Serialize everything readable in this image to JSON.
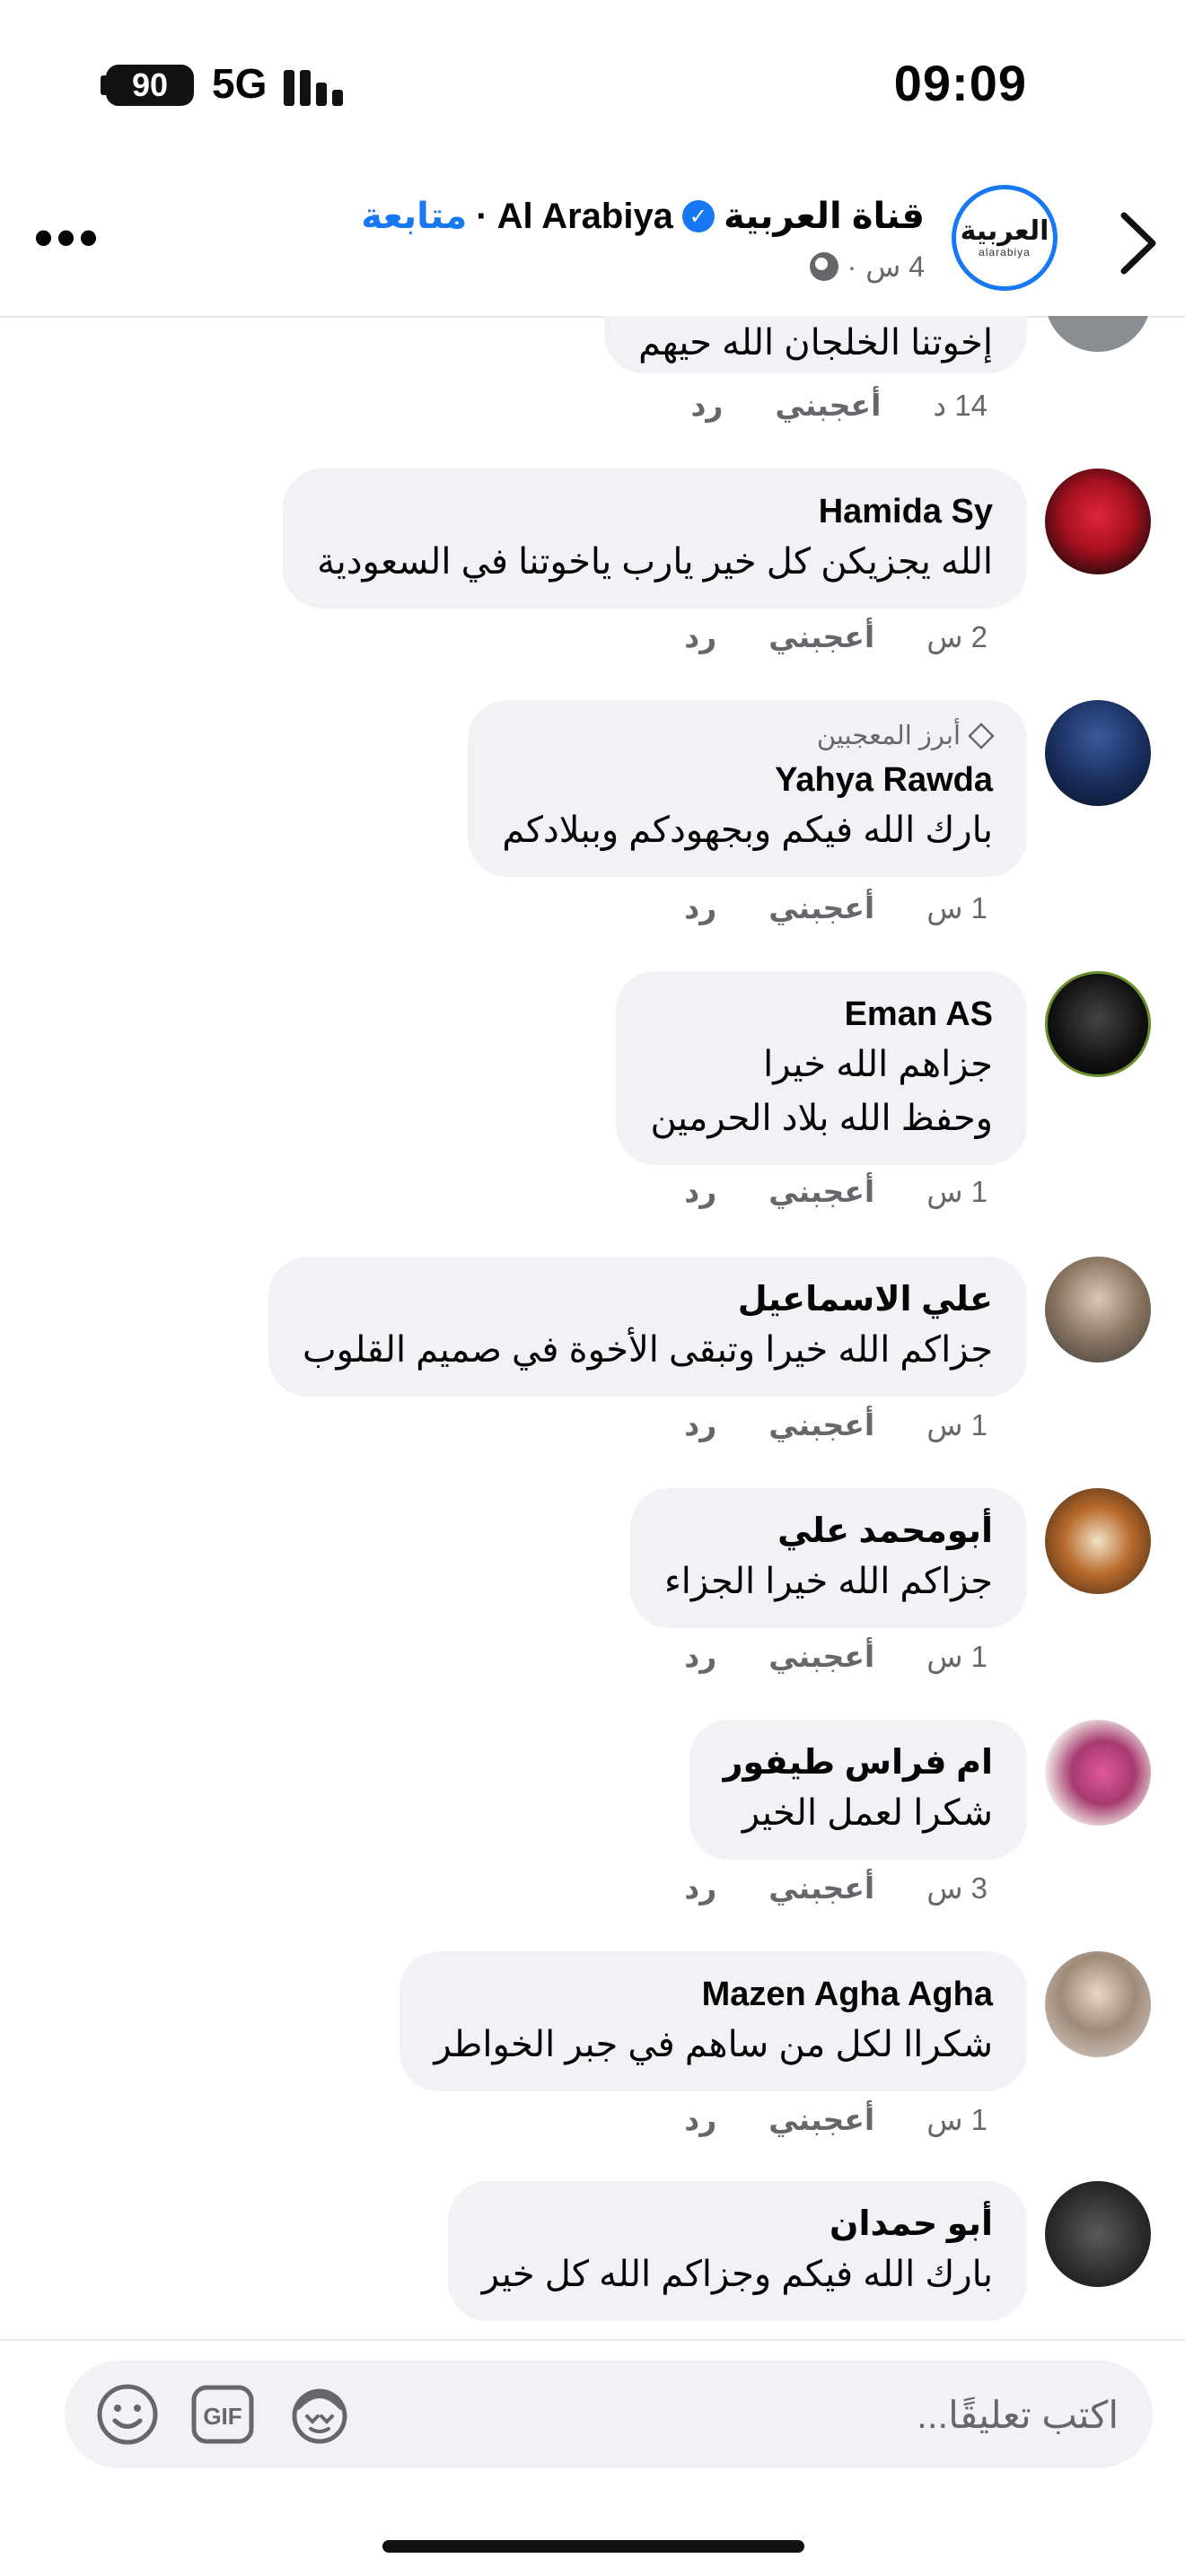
{
  "status_bar": {
    "battery": "90",
    "network": "5G",
    "time": "09:09"
  },
  "header": {
    "page_name": "قناة العربية",
    "page_name_en": "Al Arabiya",
    "separator": "·",
    "follow_label": "متابعة",
    "post_age": "4 س",
    "avatar_text_ar": "العربية",
    "avatar_text_en": "alarabiya"
  },
  "comments": [
    {
      "author": "",
      "text": "إخوتنا الخلجان الله حيهم",
      "time": "14 د",
      "like": "أعجبني",
      "reply": "رد",
      "top_fan": ""
    },
    {
      "author": "Hamida Sy",
      "text": "الله يجزيكن كل خير يارب ياخوتنا في السعودية",
      "time": "2 س",
      "like": "أعجبني",
      "reply": "رد",
      "top_fan": ""
    },
    {
      "author": "Yahya Rawda",
      "text": "بارك الله فيكم وبجهودكم وببلادكم",
      "time": "1 س",
      "like": "أعجبني",
      "reply": "رد",
      "top_fan": "أبرز المعجبين"
    },
    {
      "author": "Eman AS",
      "text": "جزاهم الله خيرا\nوحفظ الله بلاد الحرمين",
      "time": "1 س",
      "like": "أعجبني",
      "reply": "رد",
      "top_fan": ""
    },
    {
      "author": "علي الاسماعيل",
      "text": "جزاكم الله خيرا وتبقى الأخوة في صميم القلوب",
      "time": "1 س",
      "like": "أعجبني",
      "reply": "رد",
      "top_fan": ""
    },
    {
      "author": "أبومحمد علي",
      "text": "جزاكم الله خيرا الجزاء",
      "time": "1 س",
      "like": "أعجبني",
      "reply": "رد",
      "top_fan": ""
    },
    {
      "author": "ام فراس طيفور",
      "text": "شكرا لعمل الخير",
      "time": "3 س",
      "like": "أعجبني",
      "reply": "رد",
      "top_fan": ""
    },
    {
      "author": "Mazen Agha Agha",
      "text": "شكراا لكل من ساهم في جبر الخواطر",
      "time": "1 س",
      "like": "أعجبني",
      "reply": "رد",
      "top_fan": ""
    },
    {
      "author": "أبو حمدان",
      "text": "بارك الله فيكم وجزاكم الله كل خير",
      "time": "",
      "like": "",
      "reply": "",
      "top_fan": ""
    }
  ],
  "composer": {
    "placeholder": "اكتب تعليقًا...",
    "gif_label": "GIF"
  },
  "colors": {
    "accent": "#1877f2",
    "bubble": "#f0f2f5",
    "muted": "#65676b"
  }
}
